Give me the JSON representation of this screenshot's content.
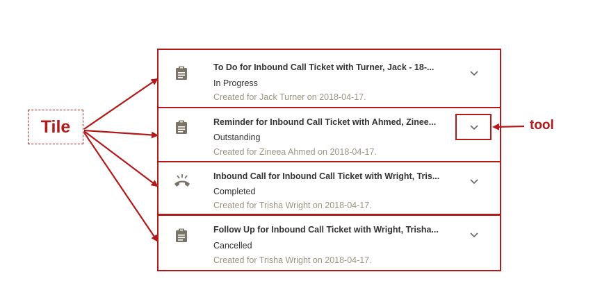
{
  "annotations": {
    "tile_label": "Tile",
    "tool_label": "tool",
    "annotation_color": "#b01a1a"
  },
  "tiles": [
    {
      "icon": "clipboard-icon",
      "title": "To Do for Inbound Call Ticket with Turner, Jack - 18-...",
      "status": "In Progress",
      "created": "Created for Jack Turner on 2018-04-17."
    },
    {
      "icon": "clipboard-icon",
      "title": "Reminder for Inbound Call Ticket with Ahmed, Zinee...",
      "status": "Outstanding",
      "created": "Created for Zineea Ahmed on 2018-04-17."
    },
    {
      "icon": "phone-call-icon",
      "title": "Inbound Call for Inbound Call Ticket with Wright, Tris...",
      "status": "Completed",
      "created": "Created for Trisha Wright on 2018-04-17."
    },
    {
      "icon": "clipboard-icon",
      "title": "Follow Up for Inbound Call Ticket with Wright, Trisha...",
      "status": "Cancelled",
      "created": "Created for Trisha Wright on 2018-04-17."
    }
  ],
  "colors": {
    "icon": "#7a7466",
    "title": "#333333",
    "created": "#9b9582"
  }
}
